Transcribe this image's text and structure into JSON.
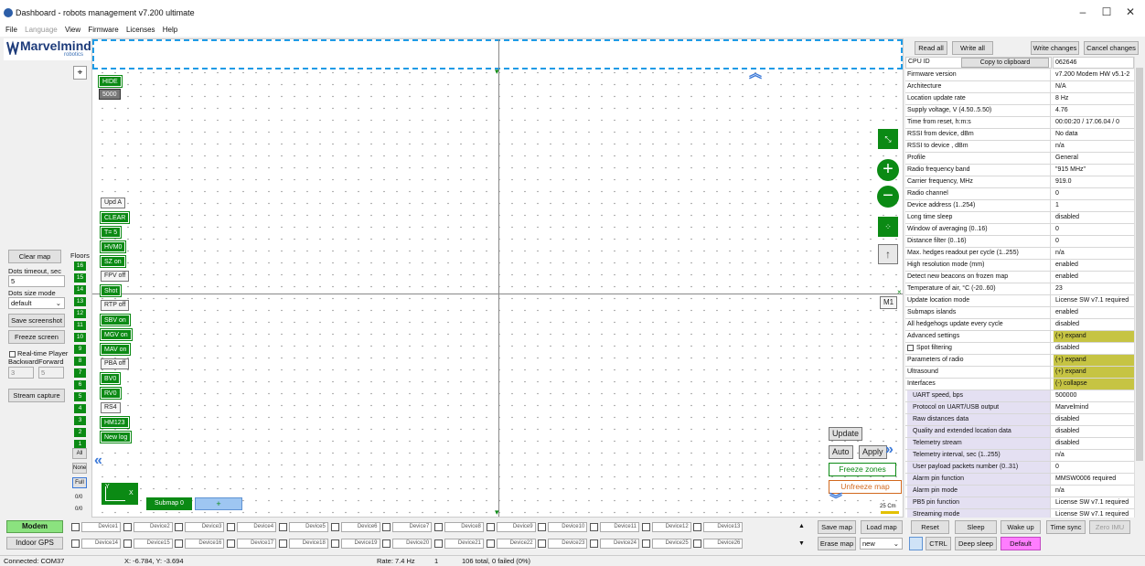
{
  "window": {
    "title": "Dashboard - robots management  v7.200  ultimate",
    "minimize": "–",
    "maximize": "☐",
    "close": "✕"
  },
  "menu": [
    {
      "label": "File",
      "disabled": false
    },
    {
      "label": "Language",
      "disabled": true
    },
    {
      "label": "View",
      "disabled": false
    },
    {
      "label": "Firmware",
      "disabled": false
    },
    {
      "label": "Licenses",
      "disabled": false
    },
    {
      "label": "Help",
      "disabled": false
    }
  ],
  "logo": {
    "name": "Marvelmind",
    "sub": "robotics"
  },
  "left": {
    "clear_map": "Clear map",
    "dots_timeout_label": "Dots timeout, sec",
    "dots_timeout_value": "5",
    "dots_size_label": "Dots size mode",
    "dots_size_value": "default",
    "save_screenshot": "Save screenshot",
    "freeze_screen": "Freeze screen",
    "realtime_player": "Real-time Player",
    "backward": "Backward",
    "forward": "Forward",
    "player_a": "3",
    "player_b": "5",
    "stream_capture": "Stream capture"
  },
  "floors": {
    "label": "Floors",
    "items": [
      "16",
      "15",
      "14",
      "13",
      "12",
      "11",
      "10",
      "9",
      "8",
      "7",
      "6",
      "5",
      "4",
      "3",
      "2",
      "1"
    ],
    "all": "All",
    "none": "None",
    "full": "Full",
    "c1": "0/0",
    "c2": "0/0"
  },
  "map": {
    "hide": "HIDE",
    "hide_val": "5000",
    "buttons": [
      {
        "label": "Upd A",
        "style": "w"
      },
      {
        "label": "CLEAR",
        "style": "g"
      },
      {
        "label": "T= 5",
        "style": "g"
      },
      {
        "label": "HVM0",
        "style": "g"
      },
      {
        "label": "SZ on",
        "style": "g"
      },
      {
        "label": "FPV off",
        "style": "w"
      },
      {
        "label": "Shot",
        "style": "g"
      },
      {
        "label": "RTP off",
        "style": "w"
      },
      {
        "label": "SBV on",
        "style": "g"
      },
      {
        "label": "MGV on",
        "style": "g"
      },
      {
        "label": "MAV on",
        "style": "g"
      },
      {
        "label": "PBA off",
        "style": "w"
      },
      {
        "label": "BV0",
        "style": "g"
      },
      {
        "label": "RV0",
        "style": "g"
      },
      {
        "label": "RS4",
        "style": "w"
      },
      {
        "label": "HM123",
        "style": "g"
      },
      {
        "label": "New log",
        "style": "g"
      }
    ],
    "axis_y": "Y",
    "axis_x": "X",
    "submap": "Submap 0",
    "submap_add": "+",
    "m1": "M1",
    "update": "Update",
    "auto": "Auto",
    "apply": "Apply",
    "freeze_zones": "Freeze zones",
    "unfreeze_map": "Unfreeze map",
    "scale": "25 Cm"
  },
  "right_top": {
    "read_all": "Read all",
    "write_all": "Write all",
    "write_changes": "Write changes",
    "cancel_changes": "Cancel changes"
  },
  "props": {
    "cpu_label": "CPU ID",
    "copy": "Copy to clipboard",
    "cpu_value": "062646",
    "rows": [
      {
        "k": "Firmware version",
        "v": "v7.200 Modem HW v5.1-2",
        "t": ""
      },
      {
        "k": "Architecture",
        "v": "N/A",
        "t": ""
      },
      {
        "k": "Location update rate",
        "v": "8 Hz",
        "t": ""
      },
      {
        "k": "Supply voltage, V (4.50..5.50)",
        "v": "4.76",
        "t": ""
      },
      {
        "k": "Time from reset, h:m:s",
        "v": "00:00:20 / 17.06.04 / 0",
        "t": ""
      },
      {
        "k": "RSSI from device, dBm",
        "v": "No data",
        "t": ""
      },
      {
        "k": "RSSI to device , dBm",
        "v": "n/a",
        "t": ""
      },
      {
        "k": "Profile",
        "v": "General",
        "t": ""
      },
      {
        "k": "Radio frequency band",
        "v": "\"915 MHz\"",
        "t": ""
      },
      {
        "k": "Carrier frequency, MHz",
        "v": "919.0",
        "t": ""
      },
      {
        "k": "Radio channel",
        "v": "0",
        "t": ""
      },
      {
        "k": "Device address (1..254)",
        "v": "1",
        "t": ""
      },
      {
        "k": "Long time sleep",
        "v": "disabled",
        "t": ""
      },
      {
        "k": "Window of averaging (0..16)",
        "v": "0",
        "t": ""
      },
      {
        "k": "Distance filter (0..16)",
        "v": "0",
        "t": ""
      },
      {
        "k": "Max. hedges readout per cycle (1..255)",
        "v": "n/a",
        "t": ""
      },
      {
        "k": "High resolution mode (mm)",
        "v": "enabled",
        "t": ""
      },
      {
        "k": "Detect new beacons on frozen map",
        "v": "enabled",
        "t": ""
      },
      {
        "k": "Temperature of air, °C (-20..60)",
        "v": "23",
        "t": ""
      },
      {
        "k": "Update location mode",
        "v": "License SW v7.1 required",
        "t": ""
      },
      {
        "k": "Submaps islands",
        "v": "enabled",
        "t": ""
      },
      {
        "k": "All hedgehogs update every cycle",
        "v": "disabled",
        "t": ""
      },
      {
        "k": "Advanced settings",
        "v": "(+) expand",
        "t": "ex"
      },
      {
        "k": "Spot filtering",
        "v": "disabled",
        "t": "cb"
      },
      {
        "k": "Parameters of radio",
        "v": "(+) expand",
        "t": "ex"
      },
      {
        "k": "Ultrasound",
        "v": "(+) expand",
        "t": "ex"
      },
      {
        "k": "Interfaces",
        "v": "(-) collapse",
        "t": "ex"
      },
      {
        "k": "UART speed, bps",
        "v": "500000",
        "t": "sub"
      },
      {
        "k": "Protocol on UART/USB output",
        "v": "Marvelmind",
        "t": "sub"
      },
      {
        "k": "Raw distances data",
        "v": "disabled",
        "t": "sub"
      },
      {
        "k": "Quality and extended location data",
        "v": "disabled",
        "t": "sub"
      },
      {
        "k": "Telemetry stream",
        "v": "disabled",
        "t": "sub"
      },
      {
        "k": "Telemetry interval, sec (1..255)",
        "v": "n/a",
        "t": "sub"
      },
      {
        "k": "User payload packets number (0..31)",
        "v": "0",
        "t": "sub"
      },
      {
        "k": "Alarm pin function",
        "v": "MMSW0006 required",
        "t": "sub"
      },
      {
        "k": "Alarm pin mode",
        "v": "n/a",
        "t": "sub"
      },
      {
        "k": "PB5 pin function",
        "v": "License SW v7.1 required",
        "t": "sub"
      },
      {
        "k": "Streaming mode",
        "v": "License SW v7.1 required",
        "t": "sub"
      }
    ]
  },
  "bottom": {
    "modem": "Modem",
    "indoor_gps": "Indoor GPS",
    "devices_row1": [
      "Device1",
      "Device2",
      "Device3",
      "Device4",
      "Device5",
      "Device6",
      "Device7",
      "Device8",
      "Device9",
      "Device10",
      "Device11",
      "Device12",
      "Device13"
    ],
    "devices_row2": [
      "Device14",
      "Device15",
      "Device16",
      "Device17",
      "Device18",
      "Device19",
      "Device20",
      "Device21",
      "Device22",
      "Device23",
      "Device24",
      "Device25",
      "Device26"
    ],
    "save_map": "Save map",
    "load_map": "Load map",
    "erase_map": "Erase map",
    "map_select": "new",
    "reset": "Reset",
    "sleep": "Sleep",
    "wake_up": "Wake up",
    "time_sync": "Time sync",
    "zero_imu": "Zero IMU",
    "ctrl": "CTRL",
    "deep_sleep": "Deep sleep",
    "default": "Default"
  },
  "status": {
    "connected": "Connected: COM37",
    "coords": "X: -6.784, Y: -3.694",
    "rate": "Rate: 7.4 Hz",
    "count": "1",
    "total": "106 total, 0 failed (0%)"
  },
  "colors": {
    "accent_green": "#0b8a14",
    "expand_yellow": "#c6c443",
    "default_pink": "#ff7dff",
    "dashed_blue": "#1e9be6"
  }
}
